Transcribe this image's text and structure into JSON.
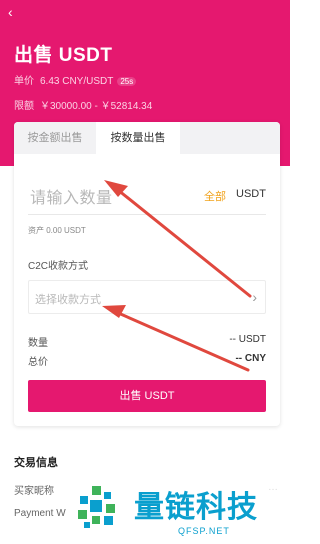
{
  "header": {
    "title": "出售 USDT",
    "price_label": "单价",
    "price_value": "6.43 CNY/USDT",
    "timer": "25s",
    "limit_label": "限额",
    "limit_value": "￥30000.00 - ￥52814.34"
  },
  "tabs": {
    "amount": "按金额出售",
    "quantity": "按数量出售"
  },
  "form": {
    "qty_placeholder": "请输入数量",
    "all_label": "全部",
    "unit": "USDT",
    "assets": "资产 0.00 USDT",
    "payment_label": "C2C收款方式",
    "payment_placeholder": "选择收款方式",
    "quantity_label": "数量",
    "quantity_value": "-- USDT",
    "total_label": "总价",
    "total_value": "-- CNY",
    "sell_button": "出售 USDT"
  },
  "trade_info": {
    "title": "交易信息",
    "buyer_nick_label": "买家昵称",
    "buyer_nick_value": "…",
    "payment_label": "Payment W"
  },
  "watermark": {
    "name": "量链科技",
    "url": "QFSP.NET"
  },
  "colors": {
    "brand": "#e5186f",
    "accent_orange": "#f0a21b",
    "arrow": "#e0483e",
    "watermark": "#0a9fce"
  },
  "icons": {
    "back": "back-arrow-icon",
    "chevron": "chevron-right-icon"
  }
}
